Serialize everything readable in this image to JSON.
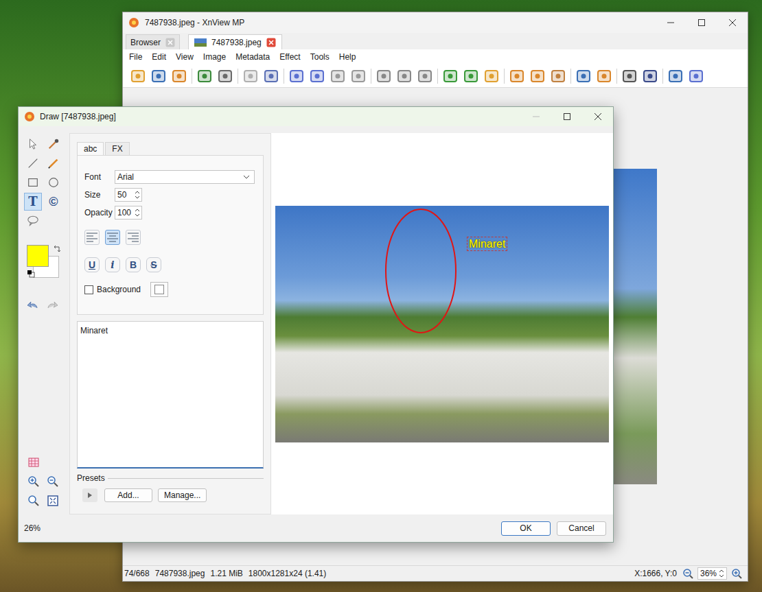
{
  "main_window": {
    "title": "7487938.jpeg - XnView MP",
    "tabs": [
      {
        "label": "Browser",
        "selected": false
      },
      {
        "label": "7487938.jpeg",
        "selected": true
      }
    ],
    "menu": [
      "File",
      "Edit",
      "View",
      "Image",
      "Metadata",
      "Effect",
      "Tools",
      "Help"
    ],
    "status_bar": {
      "items": [
        "74/668",
        "7487938.jpeg",
        "1.21 MiB",
        "1800x1281x24 (1.41)"
      ],
      "coords": "X:1666, Y:0",
      "zoom": "36%"
    }
  },
  "draw_dialog": {
    "title": "Draw [7487938.jpeg]",
    "tools": [
      {
        "kind": "select",
        "label": "",
        "selected": false
      },
      {
        "kind": "picker",
        "label": "",
        "selected": false
      },
      {
        "kind": "line",
        "label": "",
        "selected": false
      },
      {
        "kind": "pencil",
        "label": "",
        "selected": false
      },
      {
        "kind": "rectangle",
        "label": "",
        "selected": false
      },
      {
        "kind": "ellipse",
        "label": "",
        "selected": false
      },
      {
        "kind": "text",
        "label": "T",
        "selected": true
      },
      {
        "kind": "copyright",
        "label": "©",
        "selected": false
      },
      {
        "kind": "bubble",
        "label": "",
        "selected": false
      }
    ],
    "colors": {
      "foreground": "#ffff00",
      "background": "#ffffff"
    },
    "panel_tabs": [
      {
        "label": "abc",
        "selected": true
      },
      {
        "label": "FX",
        "selected": false
      }
    ],
    "font": {
      "label": "Font",
      "value": "Arial"
    },
    "size": {
      "label": "Size",
      "value": "50"
    },
    "opacity": {
      "label": "Opacity",
      "value": "100"
    },
    "alignment": [
      {
        "kind": "left",
        "selected": false
      },
      {
        "kind": "center",
        "selected": true
      },
      {
        "kind": "right",
        "selected": false
      }
    ],
    "styles": [
      {
        "label": "U",
        "kind": "underline",
        "on": false
      },
      {
        "label": "i",
        "kind": "italic",
        "on": false
      },
      {
        "label": "B",
        "kind": "bold",
        "on": false
      },
      {
        "label": "S",
        "kind": "strike",
        "on": false
      }
    ],
    "background": {
      "label": "Background",
      "checked": false,
      "color": "#ffffff"
    },
    "text": "Minaret",
    "presets": {
      "label": "Presets",
      "buttons": [
        "Add...",
        "Manage..."
      ]
    },
    "zoom": "26%",
    "annotations": [
      {
        "kind": "ellipse",
        "text": "",
        "color": "#e01515"
      },
      {
        "kind": "text",
        "text": "Minaret",
        "color": "#ffff00"
      }
    ],
    "buttons": [
      "OK",
      "Cancel"
    ]
  }
}
